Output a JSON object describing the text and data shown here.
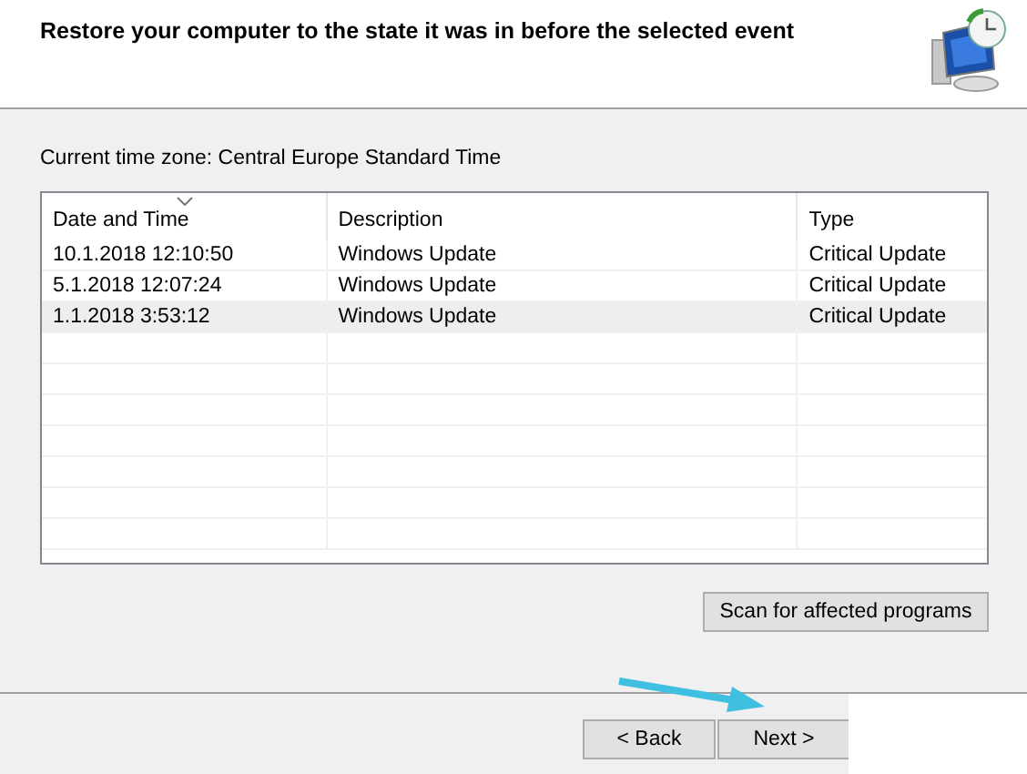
{
  "header": {
    "title": "Restore your computer to the state it was in before the selected event"
  },
  "time_zone": "Current time zone: Central Europe Standard Time",
  "table": {
    "columns": [
      "Date and Time",
      "Description",
      "Type"
    ],
    "rows": [
      {
        "cells": [
          "10.1.2018 12:10:50",
          "Windows Update",
          "Critical Update"
        ],
        "selected": false
      },
      {
        "cells": [
          "5.1.2018 12:07:24",
          "Windows Update",
          "Critical Update"
        ],
        "selected": false
      },
      {
        "cells": [
          "1.1.2018 3:53:12",
          "Windows Update",
          "Critical Update"
        ],
        "selected": true
      }
    ]
  },
  "scan_button": "Scan for affected programs",
  "buttons": [
    "< Back",
    "Next >"
  ]
}
